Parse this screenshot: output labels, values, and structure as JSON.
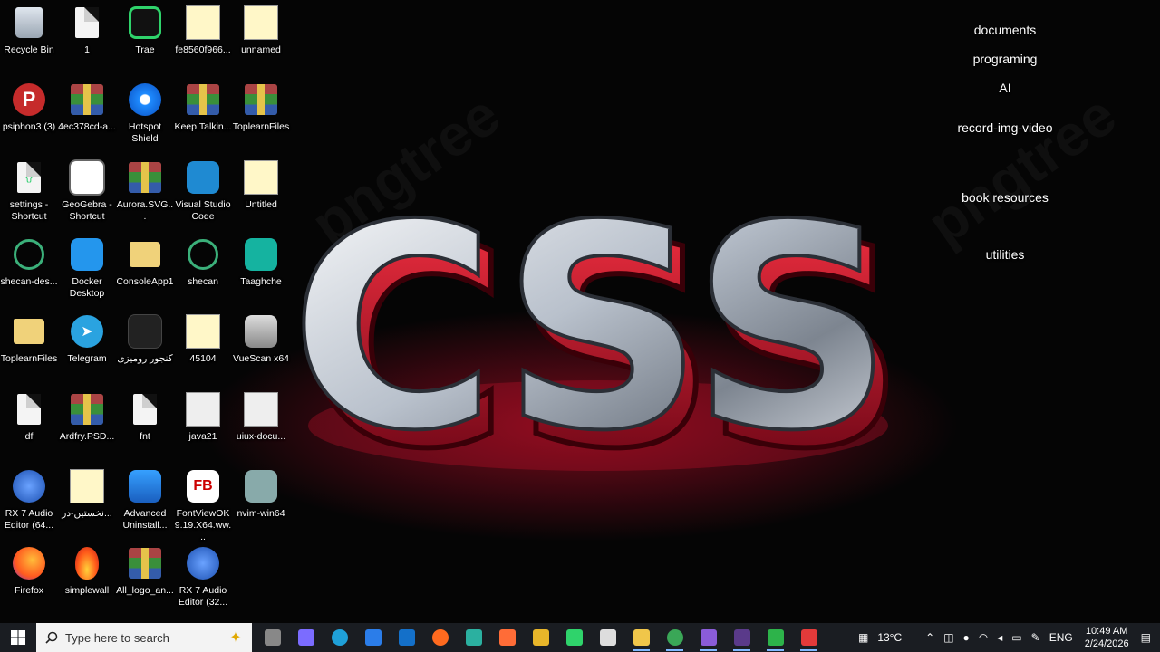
{
  "desktop": {
    "icons": [
      {
        "label": "Recycle Bin",
        "icon": "recycle-bin-icon"
      },
      {
        "label": "psiphon3 (3)",
        "icon": "psiphon-icon"
      },
      {
        "label": "settings - Shortcut",
        "icon": "json-file-icon"
      },
      {
        "label": "shecan-des...",
        "icon": "network-icon"
      },
      {
        "label": "ToplearnFiles",
        "icon": "folder-icon"
      },
      {
        "label": "df",
        "icon": "file-icon"
      },
      {
        "label": "RX 7 Audio Editor (64...",
        "icon": "rx-audio-icon"
      },
      {
        "label": "Firefox",
        "icon": "firefox-icon"
      },
      {
        "label": "1",
        "icon": "file-icon"
      },
      {
        "label": "4ec378cd-a...",
        "icon": "winrar-icon"
      },
      {
        "label": "GeoGebra - Shortcut",
        "icon": "geogebra-icon"
      },
      {
        "label": "Docker Desktop",
        "icon": "docker-icon"
      },
      {
        "label": "Telegram",
        "icon": "telegram-icon"
      },
      {
        "label": "Ardfry.PSD...",
        "icon": "winrar-icon"
      },
      {
        "label": "نخستین-در...",
        "icon": "image-file-icon"
      },
      {
        "label": "simplewall",
        "icon": "flame-icon"
      },
      {
        "label": "Trae",
        "icon": "trae-icon"
      },
      {
        "label": "Hotspot Shield",
        "icon": "hotspot-shield-icon"
      },
      {
        "label": "Aurora.SVG...",
        "icon": "winrar-icon"
      },
      {
        "label": "ConsoleApp1",
        "icon": "folder-icon"
      },
      {
        "label": "کنجور رومیزی",
        "icon": "app-icon"
      },
      {
        "label": "fnt",
        "icon": "file-icon"
      },
      {
        "label": "Advanced Uninstall...",
        "icon": "uninstaller-icon"
      },
      {
        "label": "All_logo_an...",
        "icon": "winrar-icon"
      },
      {
        "label": "fe8560f966...",
        "icon": "image-file-icon"
      },
      {
        "label": "Keep.Talkin...",
        "icon": "winrar-icon"
      },
      {
        "label": "Visual Studio Code",
        "icon": "vscode-icon"
      },
      {
        "label": "shecan",
        "icon": "network-icon"
      },
      {
        "label": "45104",
        "icon": "image-file-icon"
      },
      {
        "label": "java21",
        "icon": "document-file-icon"
      },
      {
        "label": "FontViewOK 9.19.X64.ww...",
        "icon": "fontview-icon"
      },
      {
        "label": "RX 7 Audio Editor (32...",
        "icon": "rx-audio-icon"
      },
      {
        "label": "unnamed",
        "icon": "image-file-icon"
      },
      {
        "label": "ToplearnFiles",
        "icon": "winrar-icon"
      },
      {
        "label": "Untitled",
        "icon": "image-file-icon"
      },
      {
        "label": "Taaghche",
        "icon": "taaghche-icon"
      },
      {
        "label": "VueScan x64",
        "icon": "scanner-icon"
      },
      {
        "label": "uiux-docu...",
        "icon": "document-file-icon"
      },
      {
        "label": "nvim-win64",
        "icon": "installer-icon"
      }
    ],
    "right_labels": [
      "documents",
      "programing",
      "AI",
      "record-img-video",
      "book resources",
      "utilities"
    ],
    "wallpaper_text": "CSS",
    "watermark": "pngtree"
  },
  "taskbar": {
    "search_placeholder": "Type here to search",
    "apps": [
      "task-view-icon",
      "copilot-icon",
      "edge-icon",
      "store-icon",
      "outlook-icon",
      "firefox-icon",
      "cursor-icon",
      "postman-icon",
      "paint-icon",
      "trae-icon",
      "notion-icon",
      "file-explorer-icon",
      "chrome-icon",
      "visual-studio-icon",
      "terminal-icon",
      "camtasia-icon",
      "camtasia-recorder-icon"
    ],
    "temperature": "13°C",
    "language": "ENG",
    "time": "10:49 AM",
    "date": "2/24/2026"
  },
  "colors": {
    "accent": "#e0102a",
    "taskbar": "#1a1d22"
  }
}
